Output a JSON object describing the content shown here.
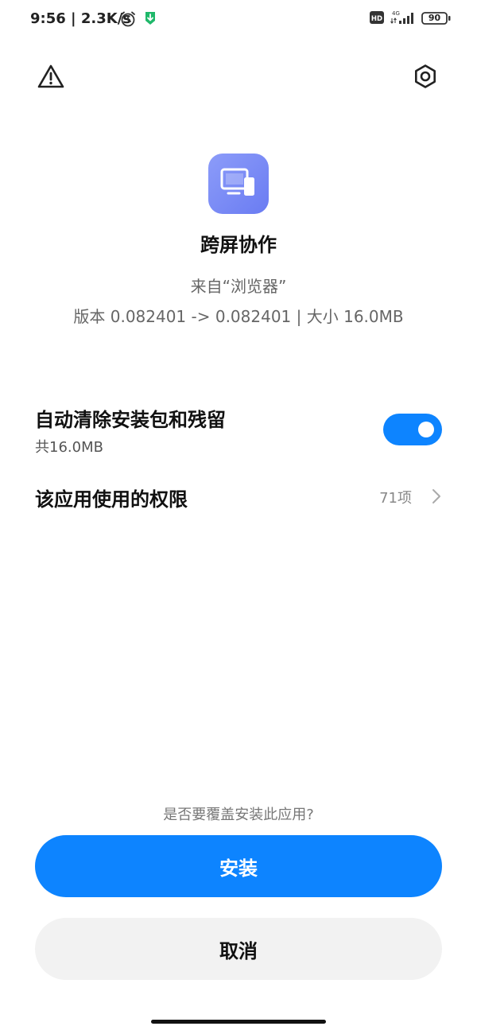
{
  "status_bar": {
    "time": "9:56",
    "net_speed": "2.3K/s",
    "network": "4G",
    "battery": "90",
    "hd_label": "HD",
    "icons": [
      "alarm-icon",
      "download-icon",
      "hd-icon",
      "signal-icon",
      "battery-icon"
    ]
  },
  "header": {
    "icons": [
      "warning-icon",
      "settings-icon"
    ]
  },
  "app": {
    "name": "跨屏协作",
    "source": "来自“浏览器”",
    "version_line": "版本 0.082401 -> 0.082401 | 大小 16.0MB",
    "icon": "screen-cast-icon",
    "icon_color": "#7b8bf5"
  },
  "options": {
    "auto_clean": {
      "title": "自动清除安装包和残留",
      "subtitle": "共16.0MB",
      "enabled": true
    },
    "permissions": {
      "title": "该应用使用的权限",
      "count": "71项"
    }
  },
  "footer": {
    "question": "是否要覆盖安装此应用?",
    "install_label": "安装",
    "cancel_label": "取消"
  },
  "colors": {
    "accent": "#0d84ff",
    "secondary_button": "#f2f2f2"
  }
}
